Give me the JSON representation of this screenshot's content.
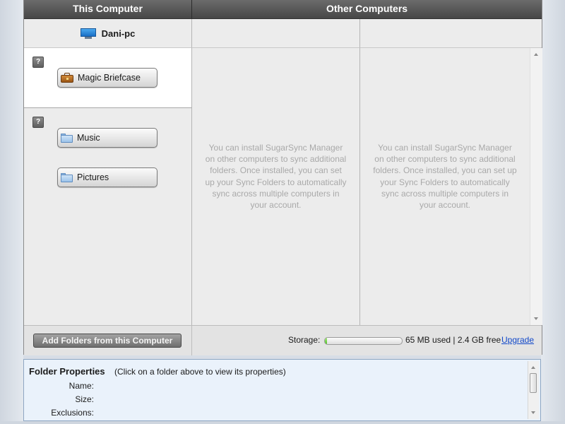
{
  "headers": {
    "this_computer": "This Computer",
    "other_computers": "Other Computers"
  },
  "this_computer": {
    "name": "Dani-pc",
    "icon": "monitor-icon",
    "help_label": "?",
    "magic_briefcase": {
      "label": "Magic Briefcase",
      "icon": "briefcase-icon"
    },
    "folders": [
      {
        "label": "Music",
        "icon": "folder-icon"
      },
      {
        "label": "Pictures",
        "icon": "folder-icon"
      }
    ],
    "add_button": "Add Folders from this Computer"
  },
  "other_computers": {
    "message": "You can install SugarSync Manager on other computers to sync additional folders. Once installed, you can set up your Sync Folders to automatically sync across multiple computers in your account."
  },
  "storage": {
    "label": "Storage:",
    "used_fraction": 0.03,
    "used_text": "65 MB used | 2.4 GB free",
    "upgrade_label": "Upgrade"
  },
  "folder_properties": {
    "title": "Folder Properties",
    "hint": "(Click on a folder above to view its properties)",
    "fields": [
      "Name:",
      "Size:",
      "Exclusions:"
    ]
  },
  "colors": {
    "header_bg": "#474747",
    "link": "#1148c9",
    "storage_fill": "#4fbf28",
    "properties_bg": "#eaf2fb"
  }
}
